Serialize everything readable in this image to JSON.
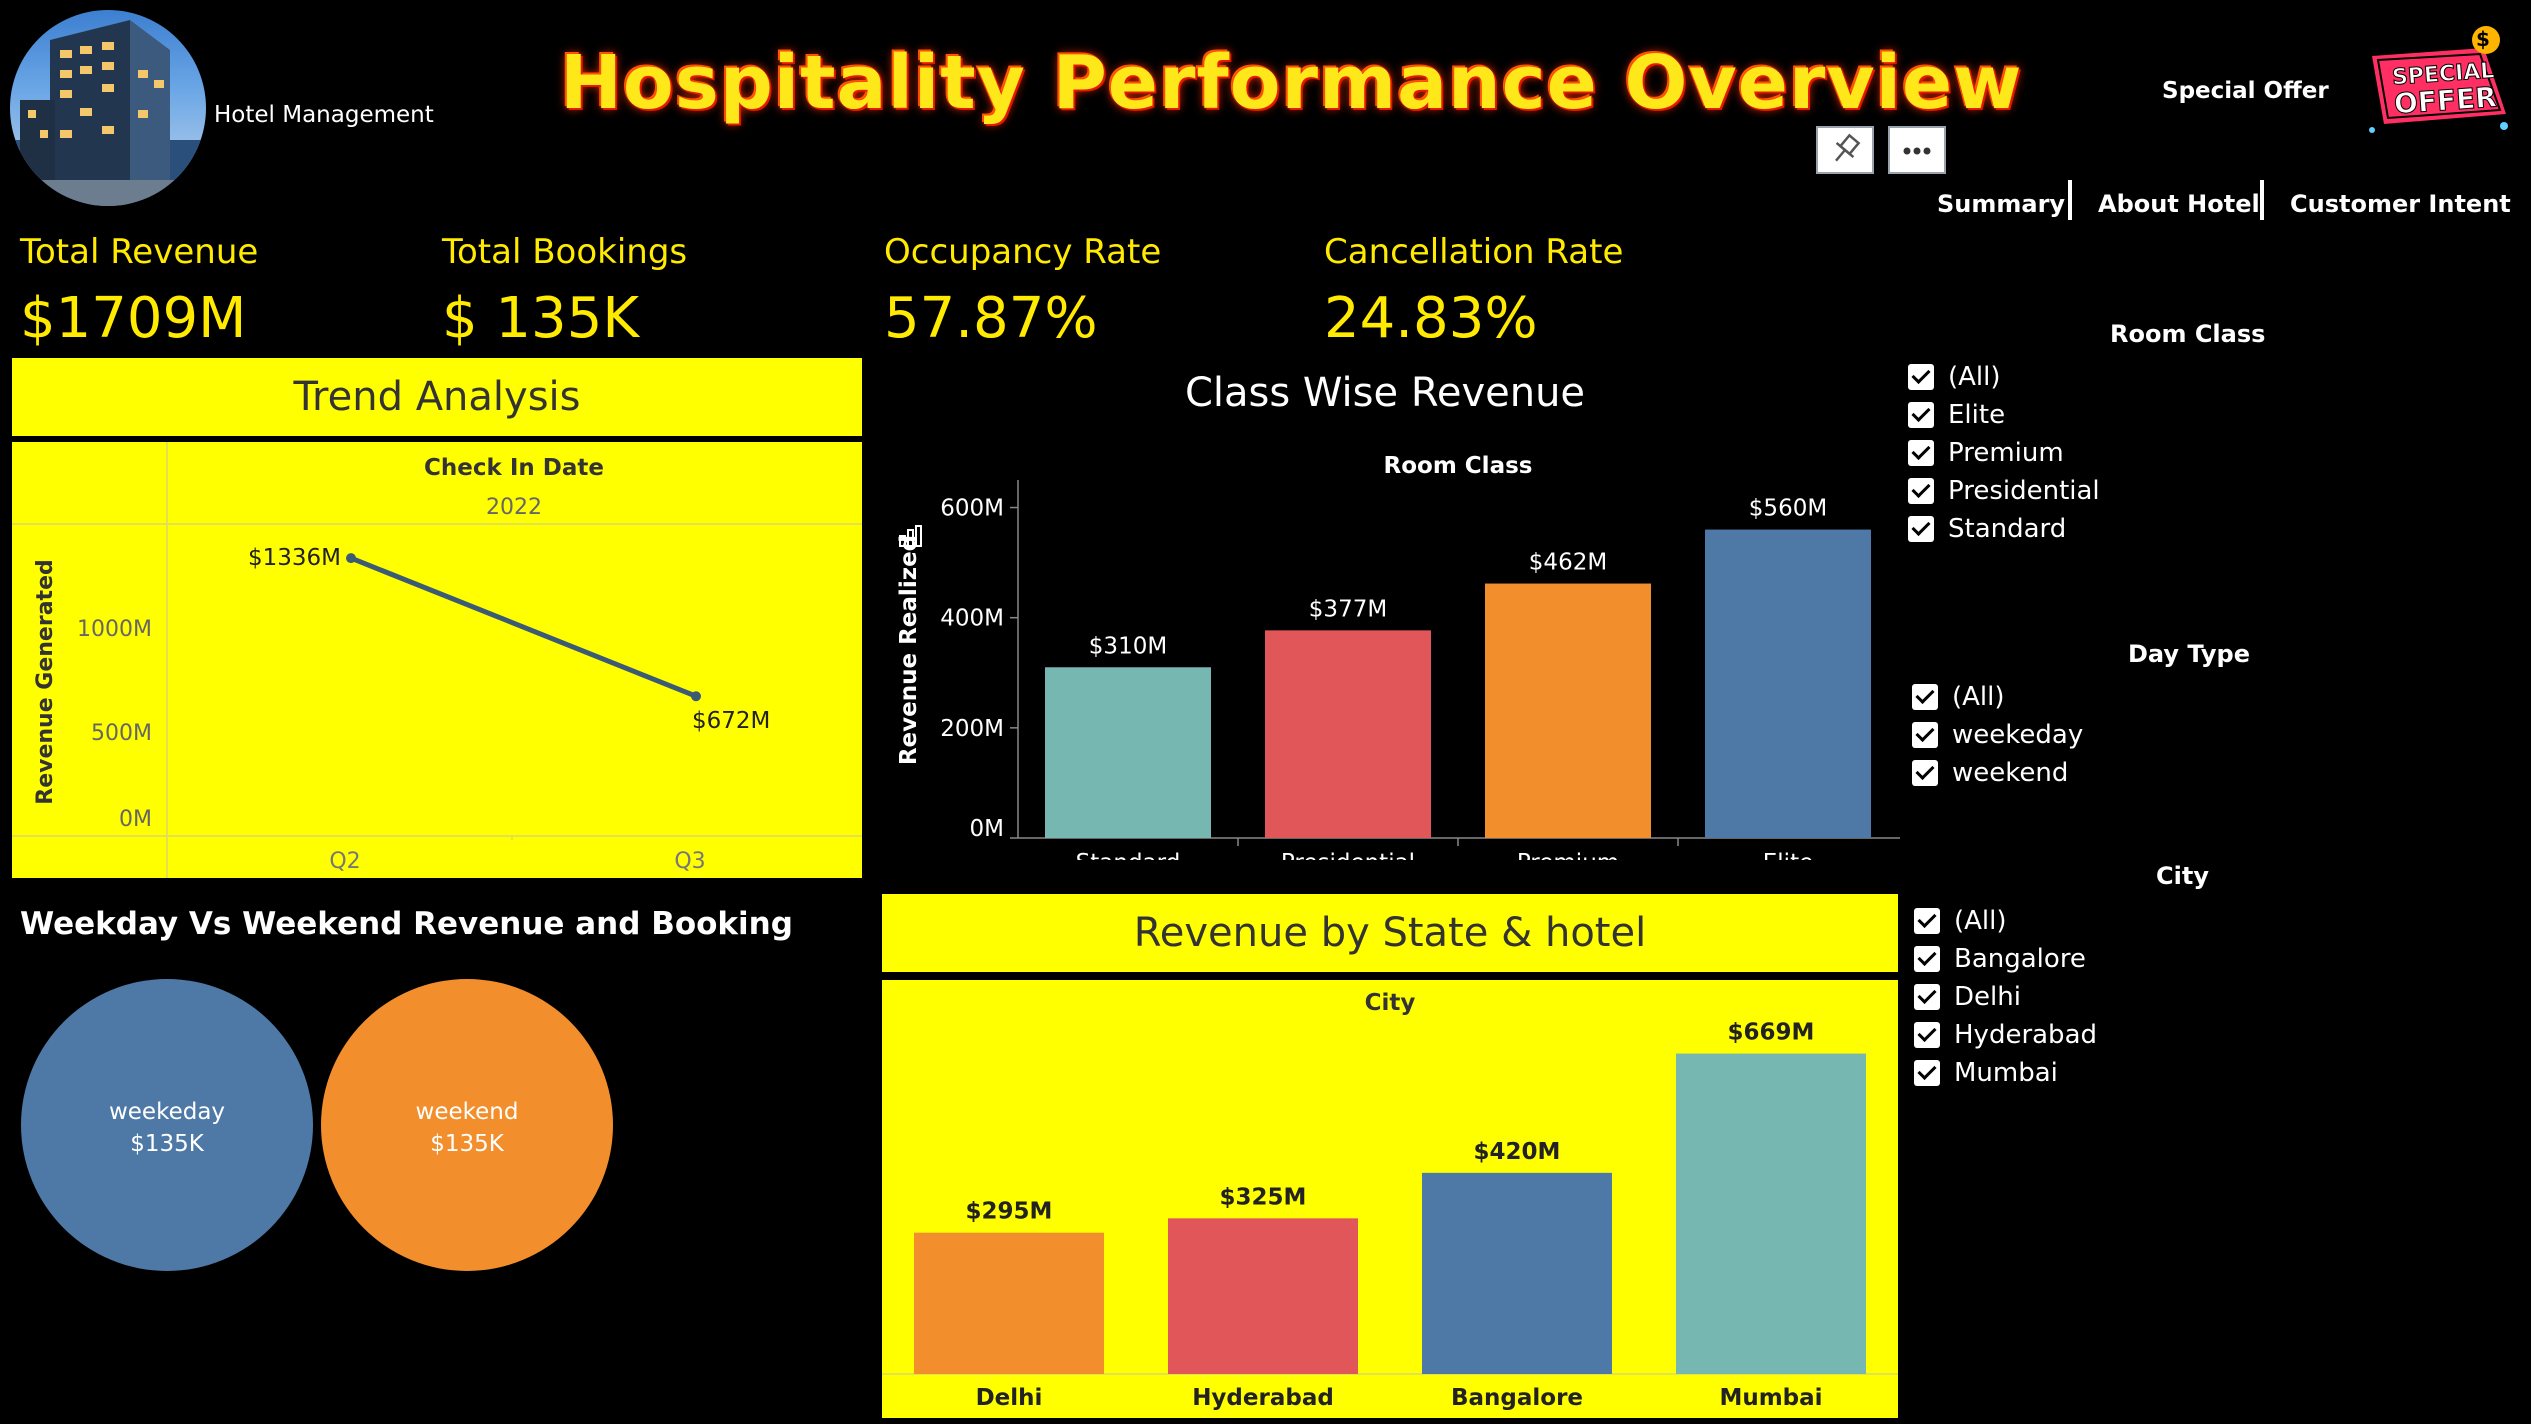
{
  "header": {
    "brand": "Hotel Management",
    "title": "Hospitality Performance Overview",
    "special_offer": "Special Offer",
    "badge_line1": "SPECIAL",
    "badge_line2": "OFFER",
    "badge_symbol": "$"
  },
  "nav": {
    "items": [
      "Summary",
      "About Hotel",
      "Customer Intent"
    ]
  },
  "kpis": [
    {
      "label": "Total Revenue",
      "value": "$1709M"
    },
    {
      "label": "Total Bookings",
      "value": "$ 135K"
    },
    {
      "label": "Occupancy Rate",
      "value": "57.87%"
    },
    {
      "label": "Cancellation Rate",
      "value": "24.83%"
    }
  ],
  "trend": {
    "title": "Trend Analysis",
    "header": "Check In Date",
    "year": "2022",
    "ylabel": "Revenue Generated"
  },
  "class_revenue": {
    "title": "Class Wise Revenue",
    "header": "Room Class",
    "ylabel": "Revenue Realized"
  },
  "weekday": {
    "title": "Weekday Vs Weekend Revenue and Booking"
  },
  "state": {
    "title": "Revenue by State & hotel",
    "header": "City"
  },
  "filters": {
    "room_class": {
      "title": "Room Class",
      "options": [
        "(All)",
        "Elite",
        "Premium",
        "Presidential",
        "Standard"
      ]
    },
    "day_type": {
      "title": "Day Type",
      "options": [
        "(All)",
        "weekeday",
        "weekend"
      ]
    },
    "city": {
      "title": "City",
      "options": [
        "(All)",
        "Bangalore",
        "Delhi",
        "Hyderabad",
        "Mumbai"
      ]
    }
  },
  "colors": {
    "accent": "#ffff00",
    "teal": "#76b7b2",
    "red": "#e15759",
    "orange": "#f28e2b",
    "blue": "#4e79a7"
  },
  "chart_data": [
    {
      "type": "line",
      "title": "Trend Analysis",
      "categories": [
        "Q2",
        "Q3"
      ],
      "values": [
        1336,
        672
      ],
      "labels": [
        "$1336M",
        "$672M"
      ],
      "ylabel": "Revenue Generated",
      "yticks": [
        "0M",
        "500M",
        "1000M"
      ],
      "ylim": [
        0,
        1500
      ]
    },
    {
      "type": "bar",
      "title": "Class Wise Revenue",
      "categories": [
        "Standard",
        "Presidential",
        "Premium",
        "Elite"
      ],
      "values": [
        310,
        377,
        462,
        560
      ],
      "labels": [
        "$310M",
        "$377M",
        "$462M",
        "$560M"
      ],
      "colors": [
        "#76b7b2",
        "#e15759",
        "#f28e2b",
        "#4e79a7"
      ],
      "ylabel": "Revenue Realized",
      "yticks": [
        "0M",
        "200M",
        "400M",
        "600M"
      ],
      "ylim": [
        0,
        650
      ]
    },
    {
      "type": "bubble",
      "title": "Weekday Vs Weekend Revenue and Booking",
      "categories": [
        "weekeday",
        "weekend"
      ],
      "labels": [
        "$135K",
        "$135K"
      ],
      "colors": [
        "#4e79a7",
        "#f28e2b"
      ]
    },
    {
      "type": "bar",
      "title": "Revenue by State & hotel",
      "categories": [
        "Delhi",
        "Hyderabad",
        "Bangalore",
        "Mumbai"
      ],
      "values": [
        295,
        325,
        420,
        669
      ],
      "labels": [
        "$295M",
        "$325M",
        "$420M",
        "$669M"
      ],
      "colors": [
        "#f28e2b",
        "#e15759",
        "#4e79a7",
        "#76b7b2"
      ],
      "ylim": [
        0,
        760
      ]
    }
  ]
}
